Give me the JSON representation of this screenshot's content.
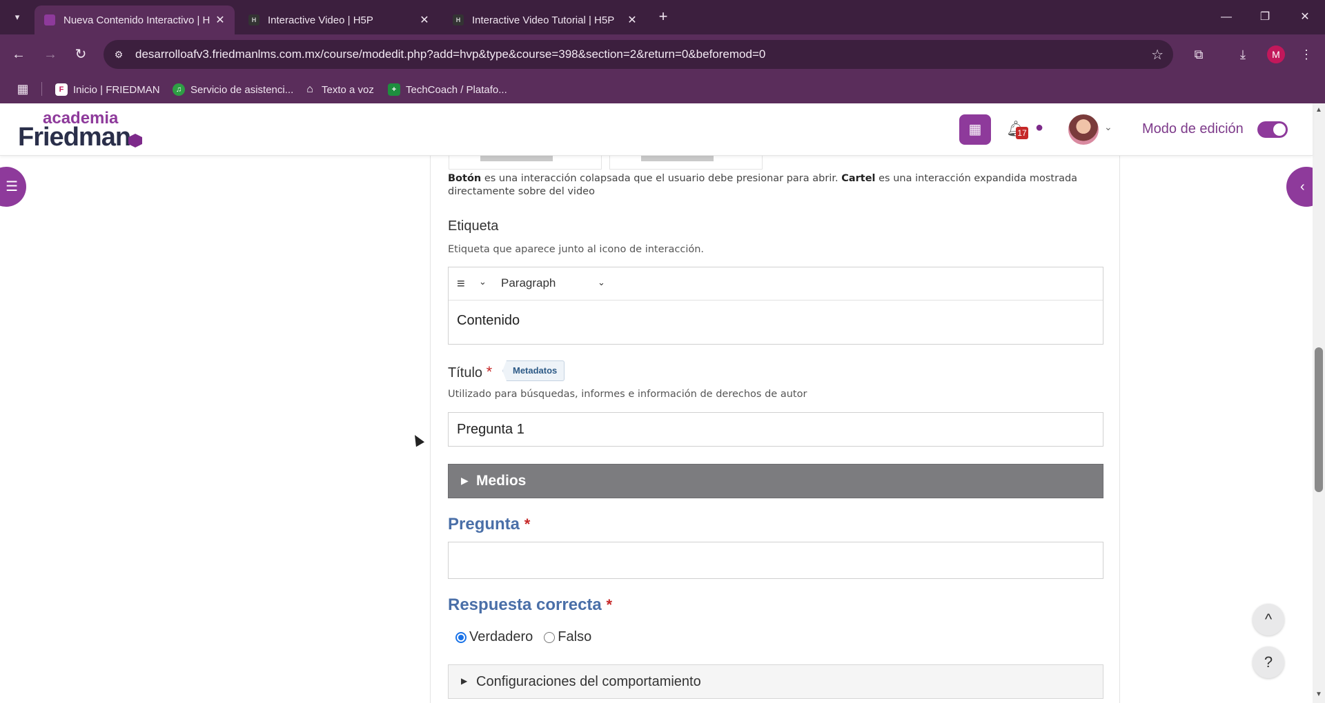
{
  "browser": {
    "tabs": [
      {
        "title": "Nueva Contenido Interactivo | H",
        "favicon": "moodle-favicon",
        "active": true
      },
      {
        "title": "Interactive Video | H5P",
        "favicon": "h5p-favicon",
        "active": false
      },
      {
        "title": "Interactive Video Tutorial | H5P",
        "favicon": "h5p-favicon",
        "active": false
      }
    ],
    "url": "desarrolloafv3.friedmanlms.com.mx/course/modedit.php?add=hvp&type&course=398&section=2&return=0&beforemod=0",
    "profile_initial": "M",
    "bookmarks": [
      {
        "label": "Inicio | FRIEDMAN",
        "icon": "friedman-icon"
      },
      {
        "label": "Servicio de asistenci...",
        "icon": "headset-icon"
      },
      {
        "label": "Texto a voz",
        "icon": "home-icon"
      },
      {
        "label": "TechCoach / Platafo...",
        "icon": "sheets-icon"
      }
    ]
  },
  "header": {
    "logo_top": "academia",
    "logo_bottom": "Friedman",
    "notifications_count": "17",
    "edit_mode_label": "Modo de edición",
    "edit_mode_on": true,
    "accent_color": "#8e3a9b"
  },
  "form": {
    "type_description_bold_1": "Botón",
    "type_description_1": " es una interacción colapsada que el usuario debe presionar para abrir. ",
    "type_description_bold_2": "Cartel",
    "type_description_2": " es una interacción expandida mostrada directamente sobre del video",
    "label_field": {
      "label": "Etiqueta",
      "help": "Etiqueta que aparece junto al icono de interacción.",
      "format": "Paragraph",
      "content": "Contenido"
    },
    "title_field": {
      "label": "Título",
      "metadata_button": "Metadatos",
      "help": "Utilizado para búsquedas, informes e información de derechos de autor",
      "value": "Pregunta 1"
    },
    "media_section": "Medios",
    "question_field": {
      "label": "Pregunta",
      "value": ""
    },
    "correct_answer": {
      "label": "Respuesta correcta",
      "options": [
        {
          "label": "Verdadero",
          "checked": true
        },
        {
          "label": "Falso",
          "checked": false
        }
      ]
    },
    "behaviour_section": "Configuraciones del comportamiento"
  },
  "floating": {
    "back_to_top": "^",
    "help": "?"
  }
}
